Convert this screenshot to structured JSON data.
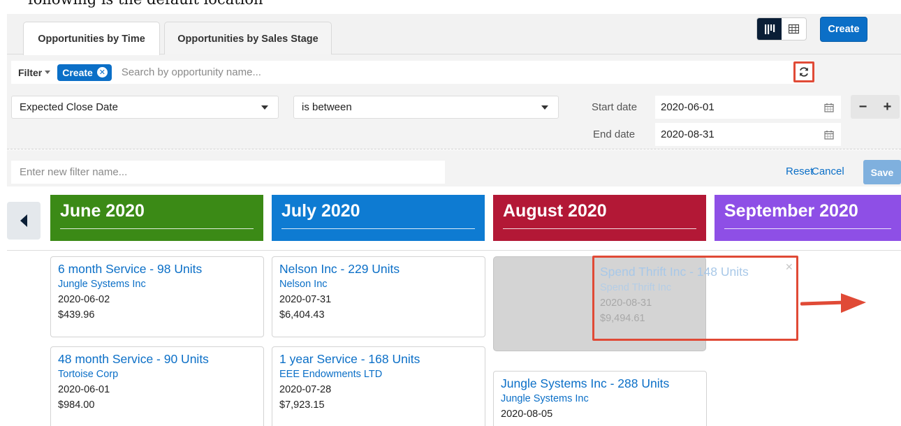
{
  "caption": "following is the default location",
  "tabs": [
    {
      "label": "Opportunities by Time"
    },
    {
      "label": "Opportunities by Sales Stage"
    }
  ],
  "toolbar": {
    "create_label": "Create"
  },
  "filter": {
    "label": "Filter",
    "pill_label": "Create",
    "search_placeholder": "Search by opportunity name..."
  },
  "criteria": {
    "field": "Expected Close Date",
    "operator": "is between",
    "start_label": "Start date",
    "start_value": "2020-06-01",
    "end_label": "End date",
    "end_value": "2020-08-31"
  },
  "filter_name": {
    "placeholder": "Enter new filter name...",
    "reset_label": "Reset",
    "cancel_label": "Cancel",
    "save_label": "Save"
  },
  "months": [
    {
      "label": "June 2020",
      "color": "#3b8a16"
    },
    {
      "label": "July 2020",
      "color": "#0e7bd2"
    },
    {
      "label": "August 2020",
      "color": "#b31836"
    },
    {
      "label": "September 2020",
      "color": "#8e4fe6"
    }
  ],
  "cards": {
    "june_1": {
      "title": "6 month Service - 98 Units",
      "account": "Jungle Systems Inc",
      "date": "2020-06-02",
      "amount": "$439.96"
    },
    "june_2": {
      "title": "48 month Service - 90 Units",
      "account": "Tortoise Corp",
      "date": "2020-06-01",
      "amount": "$984.00"
    },
    "july_1": {
      "title": "Nelson Inc - 229 Units",
      "account": "Nelson Inc",
      "date": "2020-07-31",
      "amount": "$6,404.43"
    },
    "july_2": {
      "title": "1 year Service - 168 Units",
      "account": "EEE Endowments LTD",
      "date": "2020-07-28",
      "amount": "$7,923.15"
    },
    "aug_drag": {
      "title": "Spend Thrift Inc - 148 Units",
      "account": "Spend Thrift Inc",
      "date": "2020-08-31",
      "amount": "$9,494.61"
    },
    "aug_2": {
      "title": "Jungle Systems Inc - 288 Units",
      "account": "Jungle Systems Inc",
      "date": "2020-08-05"
    }
  },
  "accent_colors": {
    "primary": "#0b6fc7",
    "highlight": "#e04a36"
  }
}
